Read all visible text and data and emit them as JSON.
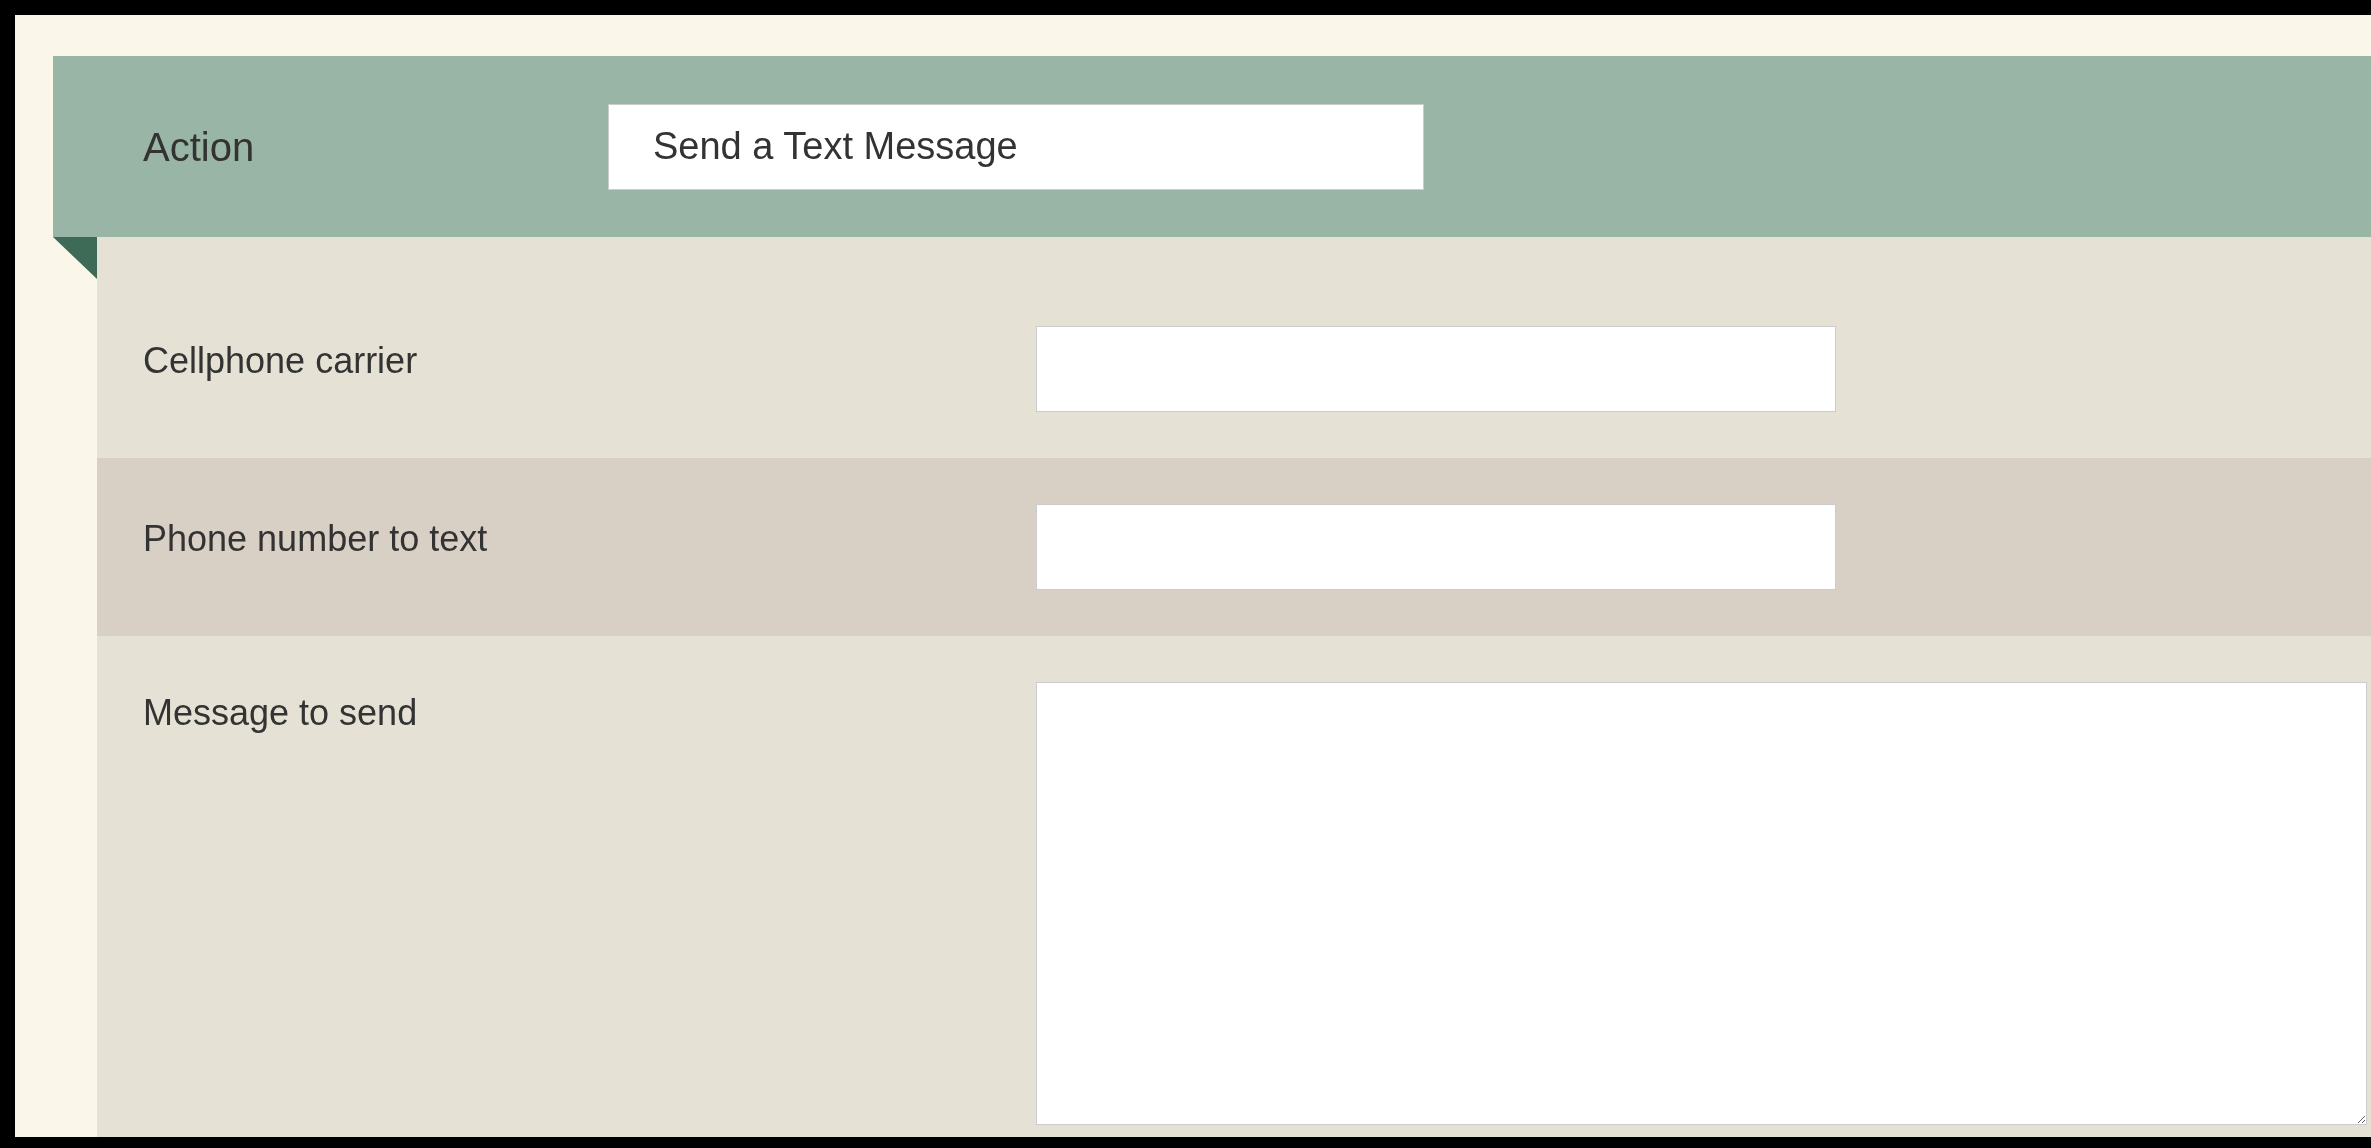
{
  "action": {
    "label": "Action",
    "value": "Send a Text Message"
  },
  "fields": [
    {
      "label": "Cellphone carrier",
      "kind": "input",
      "highlighted": false
    },
    {
      "label": "Phone number to text",
      "kind": "input",
      "highlighted": true
    },
    {
      "label": "Message to send",
      "kind": "textarea",
      "highlighted": false
    }
  ]
}
